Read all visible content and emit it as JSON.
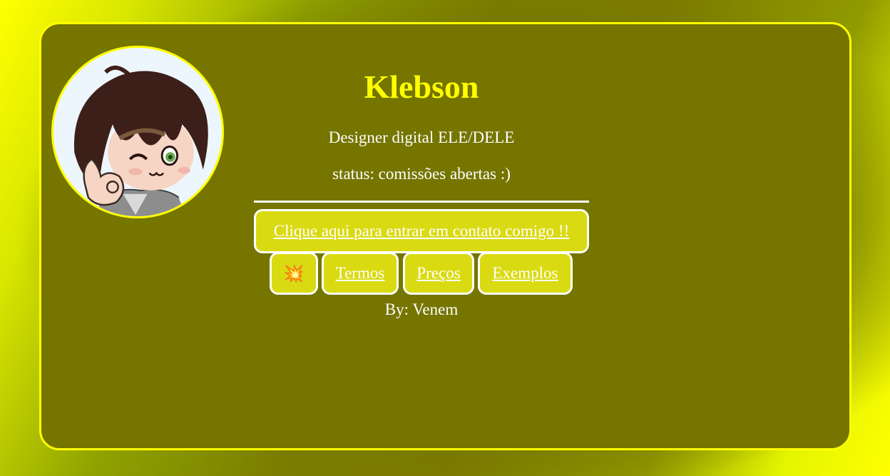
{
  "profile": {
    "name": "Klebson",
    "role": "Designer digital ELE/DELE",
    "status": "status: comissões abertas :)"
  },
  "links": {
    "contact": "Clique aqui para entrar em contato comigo !!",
    "emoji_icon": "collision-icon",
    "emoji_glyph": "💥",
    "terms": "Termos",
    "prices": "Preços",
    "examples": "Exemplos"
  },
  "footer": {
    "byline": "By: Venem"
  },
  "colors": {
    "accent": "#ffff00",
    "card_background": "#757500",
    "button_background": "#dada12"
  }
}
